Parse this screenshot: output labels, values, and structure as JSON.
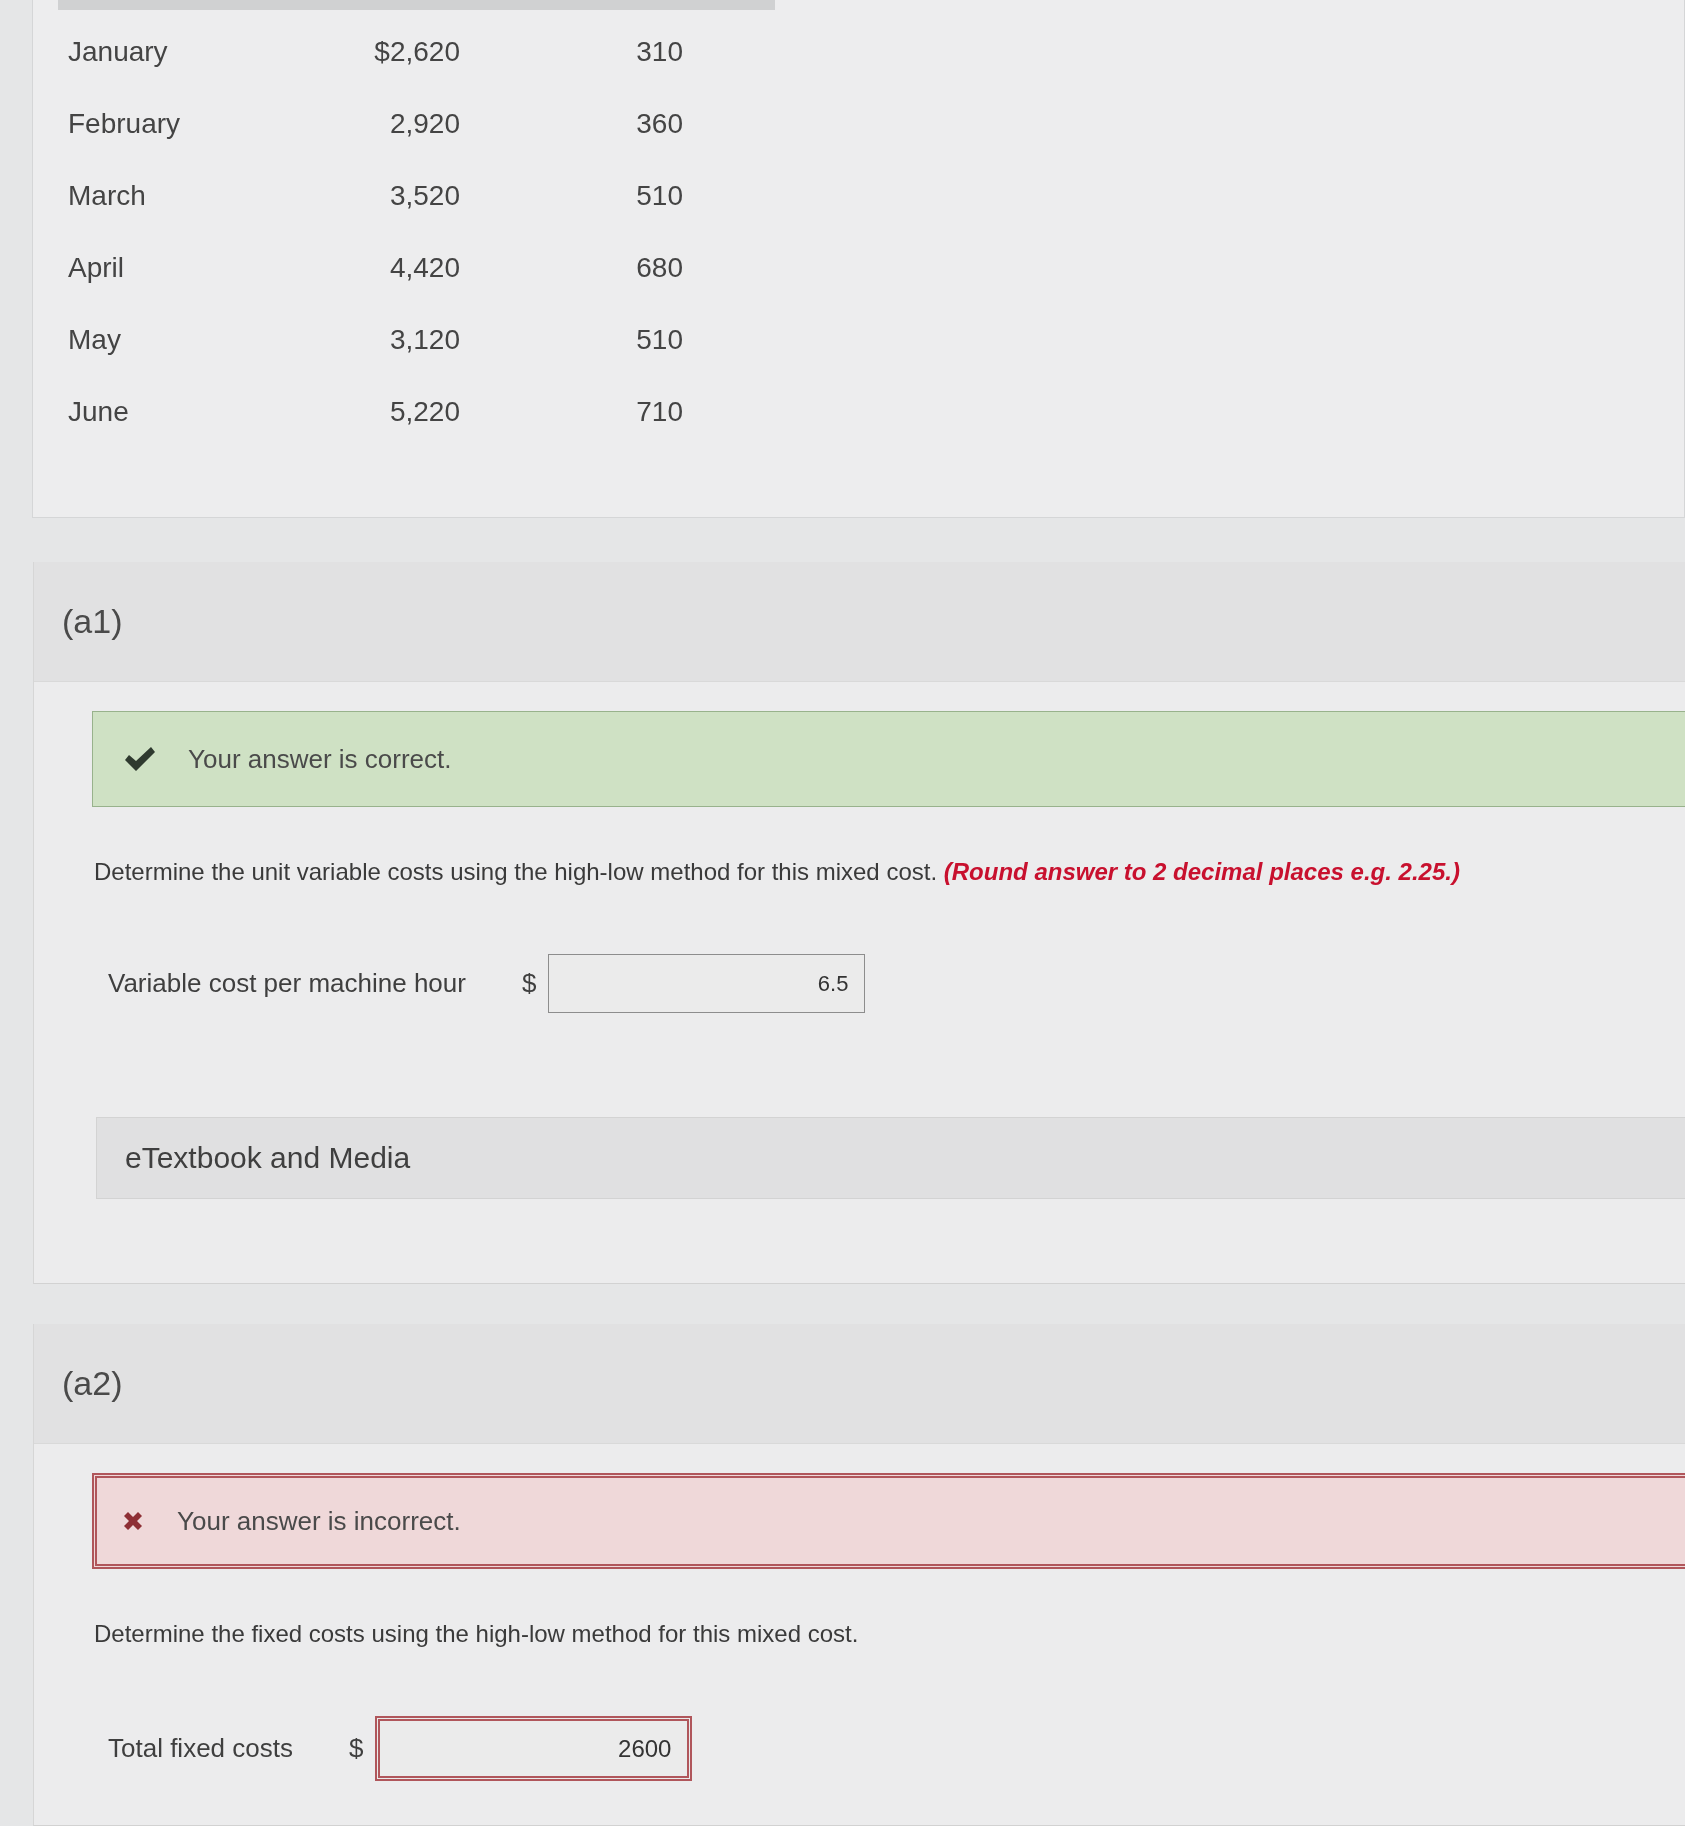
{
  "data_table": {
    "rows": [
      [
        "January",
        "$2,620",
        "310"
      ],
      [
        "February",
        "2,920",
        "360"
      ],
      [
        "March",
        "3,520",
        "510"
      ],
      [
        "April",
        "4,420",
        "680"
      ],
      [
        "May",
        "3,120",
        "510"
      ],
      [
        "June",
        "5,220",
        "710"
      ]
    ]
  },
  "parts": [
    {
      "label": "(a1)",
      "correct": true,
      "feedback": "Your answer is correct.",
      "question": "Determine the unit variable costs using the high-low method for this mixed cost. *(Round answer to 2 decimal places e.g. 2.25.)*",
      "answer": {
        "label": "Variable cost per machine hour",
        "unit": "$",
        "value": "6.5"
      },
      "resources": "eTextbook and Media"
    },
    {
      "label": "(a2)",
      "correct": false,
      "feedback": "Your answer is incorrect.",
      "question": "Determine the fixed costs using the high-low method for this mixed cost.",
      "answer": {
        "label": "Total fixed costs",
        "unit": "$",
        "value": "2600"
      }
    }
  ]
}
